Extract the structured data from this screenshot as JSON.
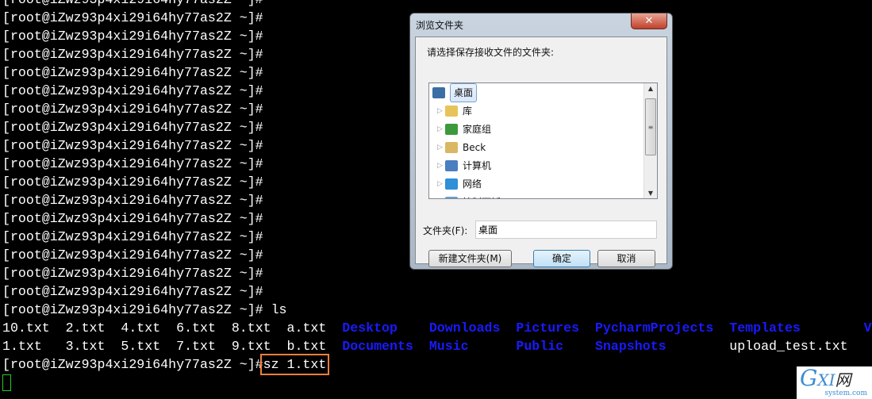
{
  "terminal": {
    "prompt": "[root@iZwz93p4xi29i64hy77as2Z ~]#",
    "empty_prompt_count": 17,
    "ls_command": "ls",
    "ls_row1": [
      {
        "t": "10.txt",
        "d": false,
        "w": 8
      },
      {
        "t": "2.txt",
        "d": false,
        "w": 7
      },
      {
        "t": "4.txt",
        "d": false,
        "w": 7
      },
      {
        "t": "6.txt",
        "d": false,
        "w": 7
      },
      {
        "t": "8.txt",
        "d": false,
        "w": 7
      },
      {
        "t": "a.txt",
        "d": false,
        "w": 7
      },
      {
        "t": "Desktop",
        "d": true,
        "w": 11
      },
      {
        "t": "Downloads",
        "d": true,
        "w": 11
      },
      {
        "t": "Pictures",
        "d": true,
        "w": 10
      },
      {
        "t": "PycharmProjects",
        "d": true,
        "w": 17
      },
      {
        "t": "Templates",
        "d": true,
        "w": 17
      },
      {
        "t": "V",
        "d": true,
        "w": 1
      }
    ],
    "ls_row2": [
      {
        "t": "1.txt",
        "d": false,
        "w": 8
      },
      {
        "t": "3.txt",
        "d": false,
        "w": 7
      },
      {
        "t": "5.txt",
        "d": false,
        "w": 7
      },
      {
        "t": "7.txt",
        "d": false,
        "w": 7
      },
      {
        "t": "9.txt",
        "d": false,
        "w": 7
      },
      {
        "t": "b.txt",
        "d": false,
        "w": 7
      },
      {
        "t": "Documents",
        "d": true,
        "w": 11
      },
      {
        "t": "Music",
        "d": true,
        "w": 11
      },
      {
        "t": "Public",
        "d": true,
        "w": 10
      },
      {
        "t": "Snapshots",
        "d": true,
        "w": 17
      },
      {
        "t": "upload_test.txt",
        "d": false,
        "w": 17
      }
    ],
    "last_command": "sz 1.txt",
    "colors": {
      "dir": "#1a1aff",
      "highlight": "#f07f3c",
      "cursor": "#22cc22"
    }
  },
  "dialog": {
    "title": "浏览文件夹",
    "close_label": "✕",
    "prompt": "请选择保存接收文件的文件夹:",
    "tree": [
      {
        "label": "桌面",
        "icon": "desktop-icon",
        "selected": true
      },
      {
        "label": "库",
        "icon": "library-icon"
      },
      {
        "label": "家庭组",
        "icon": "homegroup-icon"
      },
      {
        "label": "Beck",
        "icon": "user-folder-icon"
      },
      {
        "label": "计算机",
        "icon": "computer-icon"
      },
      {
        "label": "网络",
        "icon": "network-icon"
      },
      {
        "label": "控制面板",
        "icon": "control-panel-icon"
      }
    ],
    "folder_label": "文件夹(F):",
    "folder_value": "桌面",
    "new_folder_button": "新建文件夹(M)",
    "ok_button": "确定",
    "cancel_button": "取消"
  },
  "watermark": {
    "text": "GXI网",
    "sub": "system.com"
  }
}
